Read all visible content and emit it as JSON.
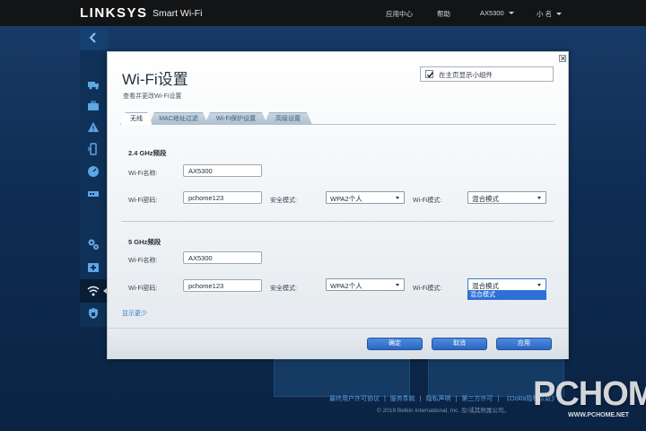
{
  "header": {
    "brand": "LINKSYS",
    "product": "Smart Wi-Fi",
    "nav": {
      "app_center": "应用中心",
      "help": "帮助",
      "router": "AX5300",
      "user": "小 名"
    }
  },
  "sidebar": {
    "items": [
      {
        "icon": "back-chevron-icon"
      },
      {
        "icon": "truck-icon"
      },
      {
        "icon": "briefcase-icon"
      },
      {
        "icon": "warning-icon"
      },
      {
        "icon": "phone-icon"
      },
      {
        "icon": "speedometer-icon"
      },
      {
        "icon": "network-switch-icon"
      },
      {
        "icon": "gears-icon"
      },
      {
        "icon": "medical-kit-icon"
      },
      {
        "icon": "wifi-icon",
        "active": true
      },
      {
        "icon": "shield-icon"
      }
    ]
  },
  "dialog": {
    "title": "Wi-Fi设置",
    "subtitle": "查看并更改Wi-Fi设置",
    "show_widget_label": "在主页显示小组件",
    "show_widget_checked": true,
    "tabs": [
      {
        "label": "无线",
        "active": true
      },
      {
        "label": "MAC地址过滤",
        "active": false
      },
      {
        "label": "Wi-Fi保护设置",
        "active": false
      },
      {
        "label": "高级设置",
        "active": false
      }
    ],
    "band24": {
      "title": "2.4 GHz频段",
      "name_label": "Wi-Fi名称:",
      "name_value": "AX5300",
      "password_label": "Wi-Fi密码:",
      "password_value": "pchome123",
      "security_label": "安全模式:",
      "security_value": "WPA2个人",
      "mode_label": "Wi-Fi模式:",
      "mode_value": "混合模式"
    },
    "band5": {
      "title": "5 GHz频段",
      "name_label": "Wi-Fi名称:",
      "name_value": "AX5300",
      "password_label": "Wi-Fi密码:",
      "password_value": "pchome123",
      "security_label": "安全模式:",
      "security_value": "WPA2个人",
      "mode_label": "Wi-Fi模式:",
      "mode_value": "混合模式",
      "mode_dropdown_option": "混合模式"
    },
    "show_less": "显示更少",
    "buttons": {
      "ok": "确定",
      "cancel": "取消",
      "apply": "应用"
    }
  },
  "footer": {
    "links": [
      "最终用户许可协议",
      "服务条款",
      "隐私声明",
      "第三方许可",
      "《Ookla隐私条款》"
    ],
    "copyright": "© 2019 Belkin International, Inc. 及/或其附属公司。"
  },
  "watermark": {
    "logo": "PCHOME",
    "url": "WWW.PCHOME.NET"
  },
  "colors": {
    "accent": "#2f6fd6",
    "topbar": "#131416",
    "background": "#0e2a4d"
  }
}
